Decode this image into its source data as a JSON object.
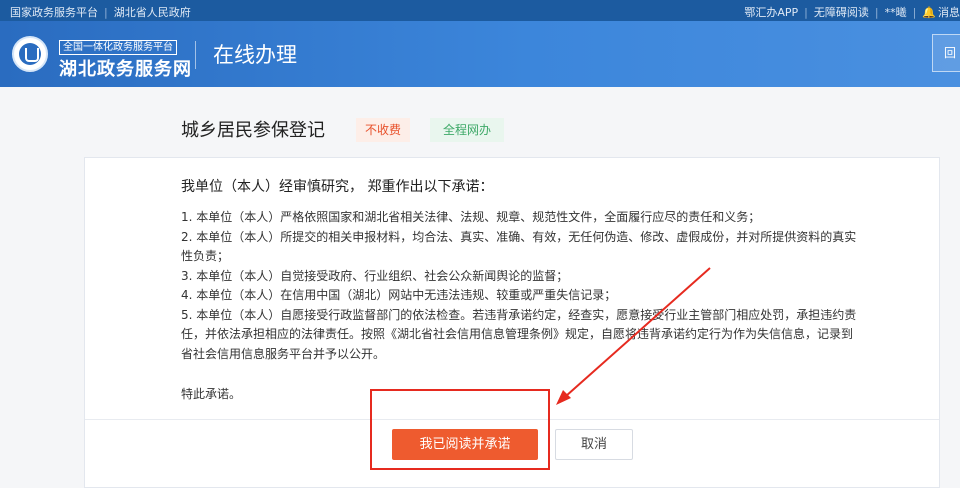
{
  "topbar": {
    "left_links": [
      "国家政务服务平台",
      "湖北省人民政府"
    ],
    "right_links": [
      "鄂汇办APP",
      "无障碍阅读",
      "**曦"
    ],
    "message_label": "消息"
  },
  "header": {
    "logo_subtitle": "全国一体化政务服务平台",
    "logo_title": "湖北政务服务网",
    "section_title": "在线办理",
    "corner_button_label": "回"
  },
  "service": {
    "title": "城乡居民参保登记",
    "tags": [
      "不收费",
      "全程网办"
    ]
  },
  "pledge": {
    "heading": "我单位（本人）经审慎研究， 郑重作出以下承诺：",
    "items": [
      "1. 本单位（本人）严格依照国家和湖北省相关法律、法规、规章、规范性文件，全面履行应尽的责任和义务；",
      "2. 本单位（本人）所提交的相关申报材料，均合法、真实、准确、有效，无任何伪造、修改、虚假成份，并对所提供资料的真实性负责；",
      "3. 本单位（本人）自觉接受政府、行业组织、社会公众新闻舆论的监督；",
      "4. 本单位（本人）在信用中国（湖北）网站中无违法违规、较重或严重失信记录；",
      "5. 本单位（本人）自愿接受行政监督部门的依法检查。若违背承诺约定，经查实，愿意接受行业主管部门相应处罚，承担违约责任，并依法承担相应的法律责任。按照《湖北省社会信用信息管理条例》规定，自愿将违背承诺约定行为作为失信信息，记录到省社会信用信息服务平台并予以公开。"
    ],
    "closing": "特此承诺。"
  },
  "actions": {
    "agree_label": "我已阅读并承诺",
    "cancel_label": "取消"
  },
  "colors": {
    "brand_blue": "#2a6cc0",
    "agree_orange": "#ee5b2f",
    "annotation_red": "#e62a1f"
  }
}
